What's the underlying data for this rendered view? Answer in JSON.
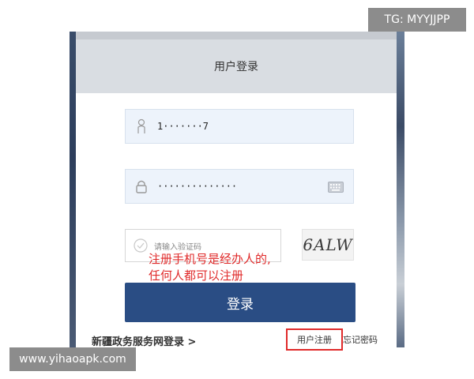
{
  "header": {
    "title": "用户登录"
  },
  "form": {
    "username_value": "1·······7",
    "password_value": "··············",
    "captcha_placeholder": "请输入验证码",
    "captcha_text": "6ALW",
    "login_label": "登录"
  },
  "annotation": "注册手机号是经办人的,\n任何人都可以注册",
  "footer": {
    "gov_link": "新疆政务服务网登录 >",
    "register": "用户注册",
    "forgot": "忘记密码"
  },
  "watermarks": {
    "top": "TG: MYYJJPP",
    "bottom": "www.yihaoapk.com"
  },
  "colors": {
    "primary": "#2a4d84",
    "annotation": "#e02a2a",
    "field_bg": "#edf3fb"
  },
  "icons": [
    "user-icon",
    "lock-icon",
    "keyboard-icon",
    "check-circle-icon"
  ]
}
